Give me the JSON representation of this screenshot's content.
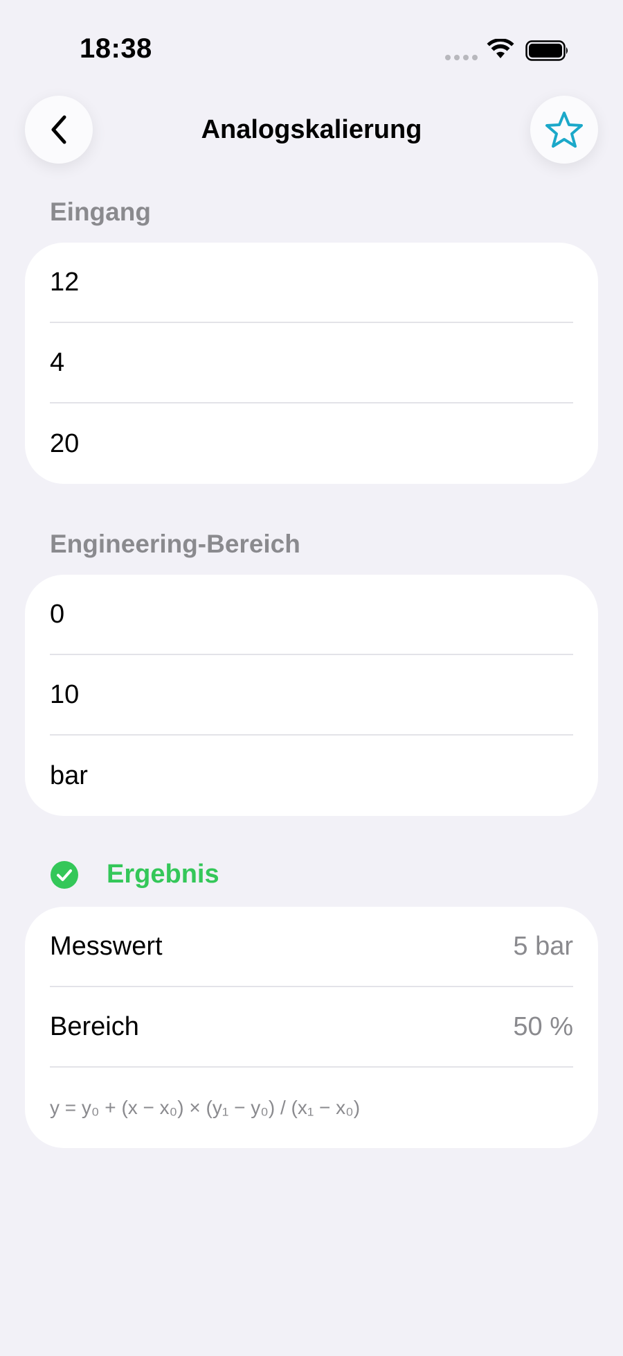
{
  "status_bar": {
    "time": "18:38"
  },
  "nav": {
    "title": "Analogskalierung",
    "back_icon": "chevron-left-icon",
    "star_icon": "star-icon",
    "accent_color": "#1ba8c9"
  },
  "input_section": {
    "header": "Eingang",
    "fields": [
      {
        "value": "12"
      },
      {
        "value": "4"
      },
      {
        "value": "20"
      }
    ]
  },
  "engineering_section": {
    "header": "Engineering-Bereich",
    "fields": [
      {
        "value": "0"
      },
      {
        "value": "10"
      },
      {
        "value": "bar"
      }
    ]
  },
  "result_section": {
    "header": "Ergebnis",
    "status_color": "#34c759",
    "rows": [
      {
        "label": "Messwert",
        "value": "5 bar"
      },
      {
        "label": "Bereich",
        "value": "50 %"
      }
    ],
    "formula": "y = y₀ + (x − x₀) × (y₁ − y₀) / (x₁ − x₀)"
  }
}
